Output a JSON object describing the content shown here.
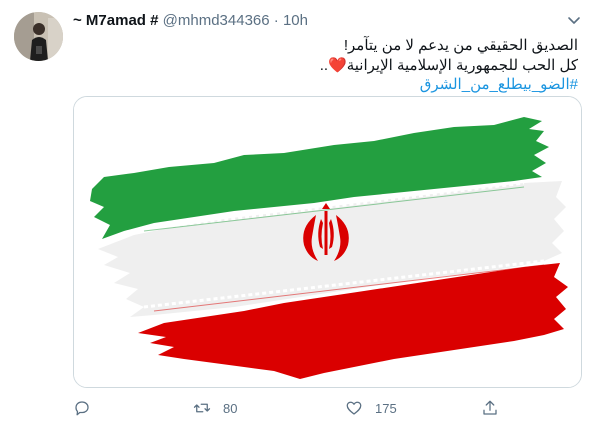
{
  "tweet": {
    "display_name": "~ M7amad #",
    "handle": "@mhmd344366",
    "separator": "·",
    "time": "10h",
    "text_line1": "الصديق الحقيقي من يدعم لا من يتآمر!",
    "text_line2": "كل الحب للجمهورية الإسلامية الإيرانية",
    "heart_emoji": "❤️",
    "trailing_dots": "..",
    "hashtag": "#الضو_بيطلع_من_الشرق"
  },
  "media": {
    "description_icon": "iran-flag-image",
    "colors": {
      "green": "#239f40",
      "white": "#f2f2f2",
      "red": "#da0000"
    }
  },
  "actions": {
    "reply_count": "",
    "retweet_count": "80",
    "like_count": "175",
    "share_count": ""
  },
  "colors": {
    "accent": "#1b95e0",
    "muted": "#5b7083",
    "border": "#cfd9de"
  }
}
